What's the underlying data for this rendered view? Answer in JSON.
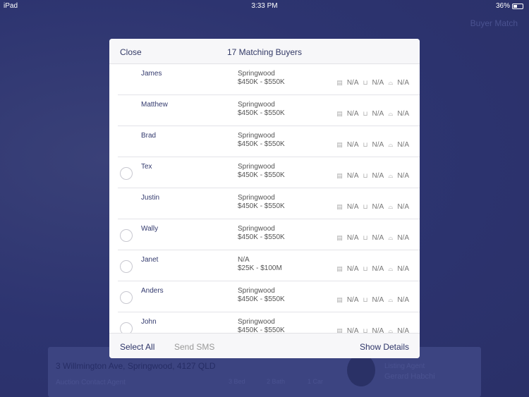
{
  "status": {
    "device": "iPad",
    "time": "3:33 PM",
    "battery": "36%"
  },
  "background": {
    "title": "Buyer Match",
    "address": "3 Willmington Ave, Springwood, 4127 QLD",
    "subtitle": "Auction Contact Agent",
    "beds": "3 Bed",
    "baths": "2 Bath",
    "cars": "1 Car",
    "agent_label": "Listing Agent",
    "agent_name": "Gerard Habchi"
  },
  "modal": {
    "close": "Close",
    "title": "17 Matching Buyers",
    "select_all": "Select All",
    "send_sms": "Send SMS",
    "show_details": "Show Details"
  },
  "buyers": [
    {
      "name": "James",
      "location": "Springwood",
      "price": "$450K - $550K",
      "bed": "N/A",
      "bath": "N/A",
      "car": "N/A",
      "radio": false
    },
    {
      "name": "Matthew",
      "location": "Springwood",
      "price": "$450K - $550K",
      "bed": "N/A",
      "bath": "N/A",
      "car": "N/A",
      "radio": false
    },
    {
      "name": "Brad",
      "location": "Springwood",
      "price": "$450K - $550K",
      "bed": "N/A",
      "bath": "N/A",
      "car": "N/A",
      "radio": false
    },
    {
      "name": "Tex",
      "location": "Springwood",
      "price": "$450K - $550K",
      "bed": "N/A",
      "bath": "N/A",
      "car": "N/A",
      "radio": true
    },
    {
      "name": "Justin",
      "location": "Springwood",
      "price": "$450K - $550K",
      "bed": "N/A",
      "bath": "N/A",
      "car": "N/A",
      "radio": false
    },
    {
      "name": "Wally",
      "location": "Springwood",
      "price": "$450K - $550K",
      "bed": "N/A",
      "bath": "N/A",
      "car": "N/A",
      "radio": true
    },
    {
      "name": "Janet",
      "location": "N/A",
      "price": "$25K - $100M",
      "bed": "N/A",
      "bath": "N/A",
      "car": "N/A",
      "radio": true
    },
    {
      "name": "Anders",
      "location": "Springwood",
      "price": "$450K - $550K",
      "bed": "N/A",
      "bath": "N/A",
      "car": "N/A",
      "radio": true
    },
    {
      "name": "John",
      "location": "Springwood",
      "price": "$450K - $550K",
      "bed": "N/A",
      "bath": "N/A",
      "car": "N/A",
      "radio": true
    }
  ]
}
